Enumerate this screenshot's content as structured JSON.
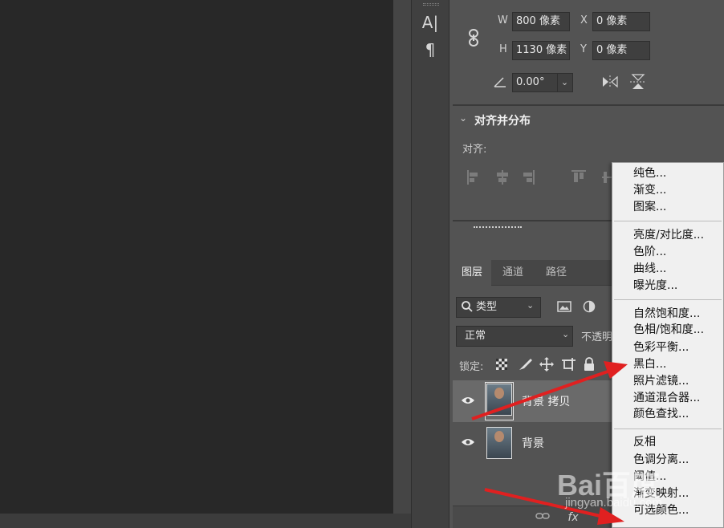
{
  "properties": {
    "w_label": "W",
    "w_value": "800 像素",
    "h_label": "H",
    "h_value": "1130 像素",
    "x_label": "X",
    "x_value": "0 像素",
    "y_label": "Y",
    "y_value": "0 像素",
    "angle_value": "0.00°"
  },
  "align": {
    "title": "对齐并分布",
    "align_label": "对齐:"
  },
  "layers_panel": {
    "tabs": [
      {
        "label": "图层"
      },
      {
        "label": "通道"
      },
      {
        "label": "路径"
      }
    ],
    "filter_value": "类型",
    "blend_mode": "正常",
    "opacity_label": "不透明",
    "lock_label": "锁定:",
    "layers": [
      {
        "name": "背景 拷贝"
      },
      {
        "name": "背景"
      }
    ],
    "fx_label": "fx"
  },
  "adjustment_menu": {
    "groups": [
      [
        "纯色...",
        "渐变...",
        "图案..."
      ],
      [
        "亮度/对比度...",
        "色阶...",
        "曲线...",
        "曝光度..."
      ],
      [
        "自然饱和度...",
        "色相/饱和度...",
        "色彩平衡...",
        "黑白...",
        "照片滤镜...",
        "通道混合器...",
        "颜色查找..."
      ],
      [
        "反相",
        "色调分离...",
        "阈值...",
        "渐变映射...",
        "可选颜色..."
      ]
    ]
  },
  "icons": {
    "text_tool": "text-tool-icon",
    "paragraph": "paragraph-icon",
    "link": "link-icon",
    "angle": "angle-icon",
    "flip_h": "flip-horizontal-icon",
    "flip_v": "flip-vertical-icon",
    "search": "search-icon",
    "eye": "eye-icon"
  },
  "watermark": {
    "brand": "Bai百度",
    "sub": "jingyan.baidu.com"
  },
  "annotation_color": "#e02020"
}
